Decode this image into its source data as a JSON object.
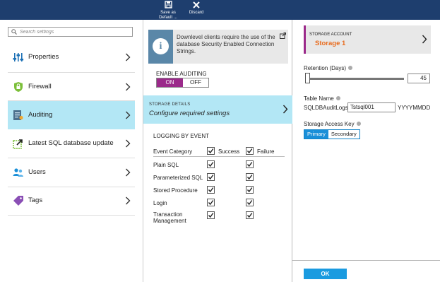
{
  "toolbar": {
    "save_line1": "Save as",
    "save_line2": "Default ...",
    "discard_label": "Discard"
  },
  "search": {
    "placeholder": "Search settings"
  },
  "nav": {
    "items": [
      {
        "label": "Properties",
        "icon": "properties-sliders-icon"
      },
      {
        "label": "Firewall",
        "icon": "firewall-shield-icon"
      },
      {
        "label": "Auditing",
        "icon": "auditing-icon",
        "active": true
      },
      {
        "label": "Latest SQL database update",
        "icon": "update-icon"
      },
      {
        "label": "Users",
        "icon": "users-icon"
      },
      {
        "label": "Tags",
        "icon": "tag-icon"
      }
    ]
  },
  "auditing": {
    "info_text": "Downlevel clients require the use of the database Security Enabled Connection Strings.",
    "enable_label": "ENABLE AUDITING",
    "on_label": "ON",
    "off_label": "OFF",
    "storage_title": "STORAGE DETAILS",
    "storage_subtitle": "Configure required settings",
    "logging_title": "LOGGING BY EVENT",
    "headers": {
      "category": "Event Category",
      "success": "Success",
      "failure": "Failure"
    },
    "rows": [
      {
        "label": "Plain SQL",
        "success": true,
        "failure": true
      },
      {
        "label": "Parameterized SQL",
        "success": true,
        "failure": true
      },
      {
        "label": "Stored Procedure",
        "success": true,
        "failure": true
      },
      {
        "label": "Login",
        "success": true,
        "failure": true
      },
      {
        "label": "Transaction Management",
        "success": true,
        "failure": true
      }
    ]
  },
  "storage": {
    "account_title": "STORAGE ACCOUNT",
    "account_value": "Storage 1",
    "retention_label": "Retention (Days)",
    "retention_value": "45",
    "table_label": "Table Name",
    "table_prefix": "SQLDBAuditLogs",
    "table_value": "Tstsql001",
    "table_suffix": "YYYYMMDD",
    "key_label": "Storage Access Key",
    "key_primary": "Primary",
    "key_secondary": "Secondary",
    "ok_label": "OK"
  },
  "colors": {
    "topbar": "#1e3e6e",
    "active": "#b3e7f5",
    "toggle_on": "#9b2a8a",
    "account_value": "#e86a1c",
    "ok": "#1a9be0"
  }
}
